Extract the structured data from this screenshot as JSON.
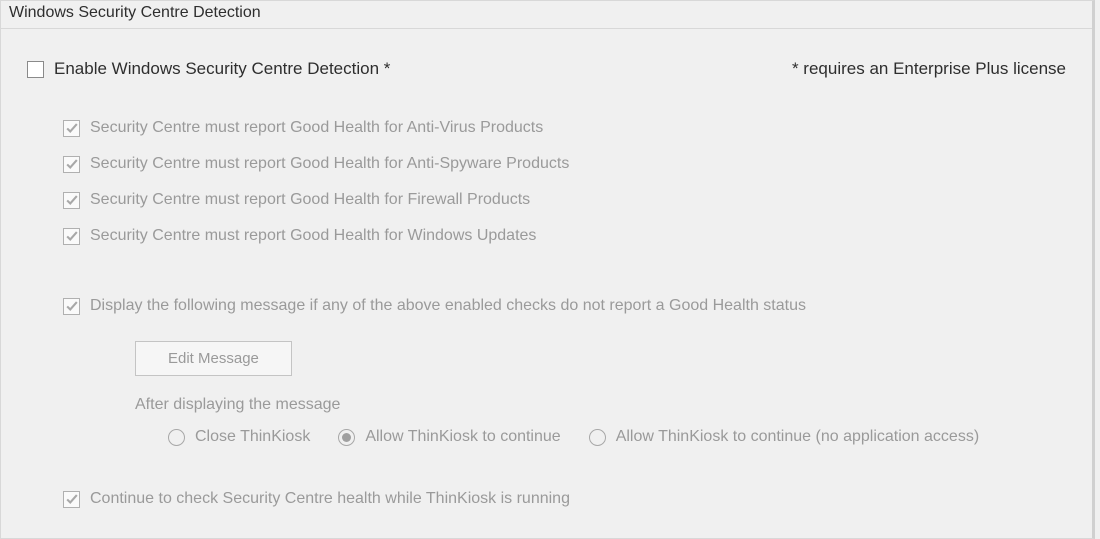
{
  "panel": {
    "title": "Windows Security Centre Detection"
  },
  "enable": {
    "label": "Enable Windows Security Centre Detection *",
    "checked": false,
    "note": "* requires an Enterprise Plus license"
  },
  "checks": [
    {
      "label": "Security Centre must report Good Health for Anti-Virus Products",
      "checked": true
    },
    {
      "label": "Security Centre must report Good Health for Anti-Spyware Products",
      "checked": true
    },
    {
      "label": "Security Centre must report Good Health for Firewall Products",
      "checked": true
    },
    {
      "label": "Security Centre must report Good Health for Windows Updates",
      "checked": true
    }
  ],
  "displayMsg": {
    "label": "Display the following message if any of the above enabled checks do not report a Good Health status",
    "checked": true,
    "editButton": "Edit Message",
    "afterLabel": "After displaying the message",
    "options": [
      {
        "label": "Close ThinKiosk",
        "selected": false
      },
      {
        "label": "Allow ThinKiosk to continue",
        "selected": true
      },
      {
        "label": "Allow ThinKiosk to continue (no application access)",
        "selected": false
      }
    ]
  },
  "continue": {
    "label": "Continue to check Security Centre health while ThinKiosk is running",
    "checked": true
  }
}
